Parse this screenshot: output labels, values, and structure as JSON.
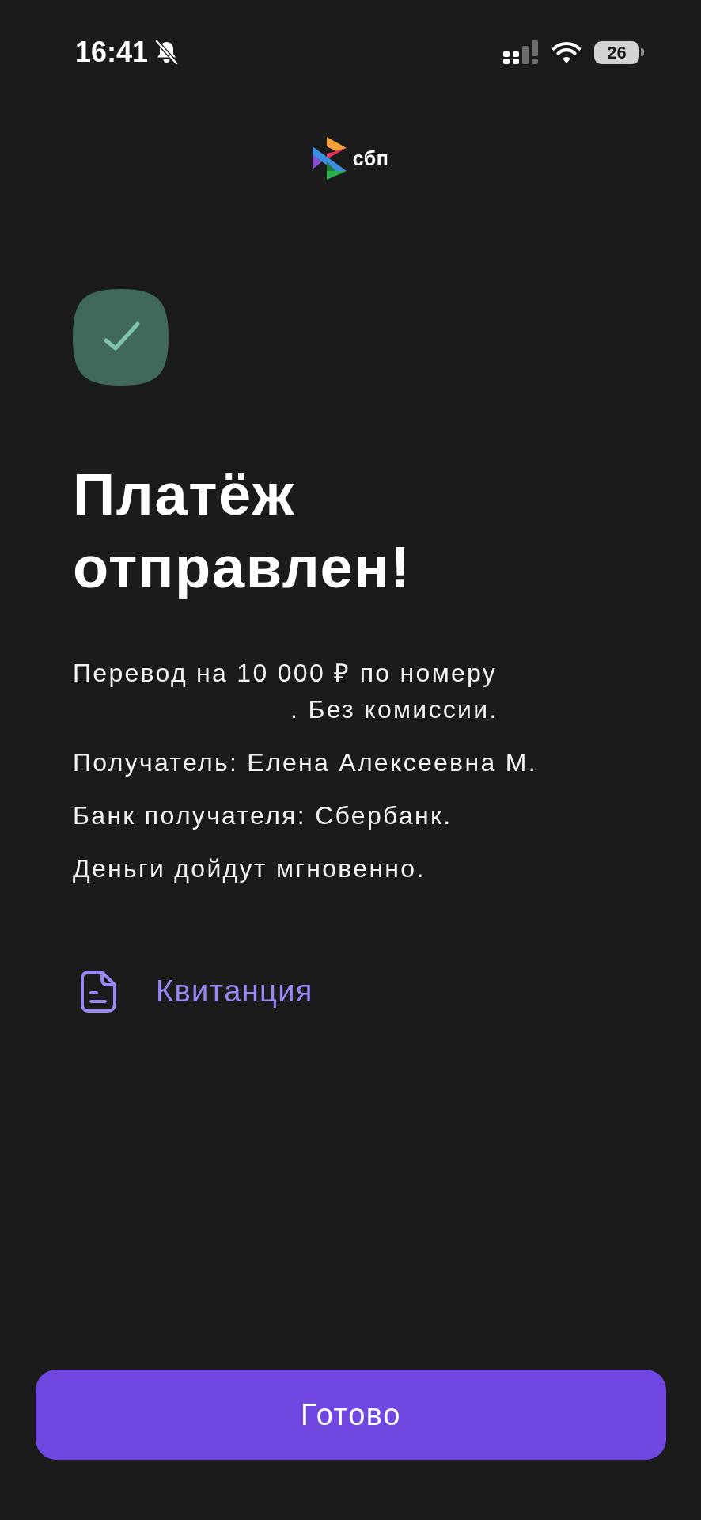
{
  "status_bar": {
    "time": "16:41",
    "silent_mode": true,
    "battery": "26"
  },
  "logo": {
    "text": "сбп"
  },
  "result": {
    "kind": "success",
    "title": "Платёж отправлен!"
  },
  "transfer_note": {
    "line_1": "Перевод на 10 000 ₽ по номеру",
    "line_2": ". Без комиссии."
  },
  "details": [
    "Получатель: Елена Алексеевна М.",
    "Банк получателя: Сбербанк.",
    "Деньги дойдут мгновенно."
  ],
  "receipt_link": {
    "label": "Квитанция"
  },
  "primary_button": {
    "label": "Готово"
  }
}
